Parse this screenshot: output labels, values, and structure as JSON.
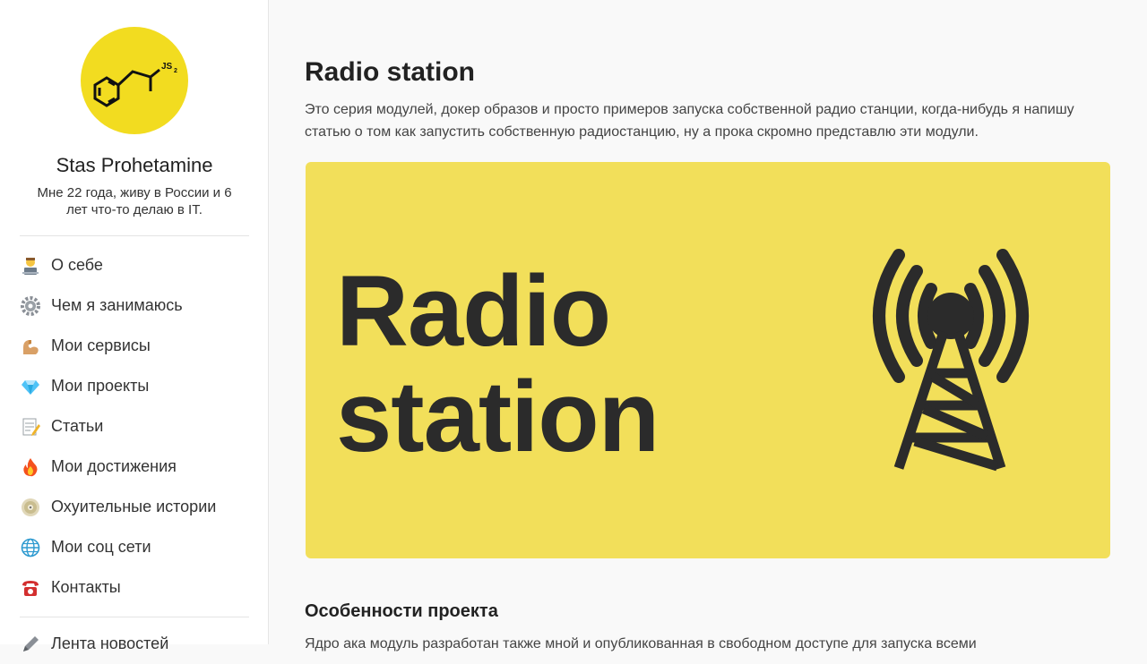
{
  "author": {
    "name": "Stas Prohetamine",
    "bio": "Мне 22 года, живу в России и 6 лет что-то делаю в IT.",
    "avatar_label": "JS",
    "avatar_subscript": "2"
  },
  "nav": {
    "items": [
      {
        "label": "О себе",
        "icon": "technologist-icon"
      },
      {
        "label": "Чем я занимаюсь",
        "icon": "gear-icon"
      },
      {
        "label": "Мои сервисы",
        "icon": "flexed-biceps-icon"
      },
      {
        "label": "Мои проекты",
        "icon": "gem-icon"
      },
      {
        "label": "Статьи",
        "icon": "memo-icon"
      },
      {
        "label": "Мои достижения",
        "icon": "fire-icon"
      },
      {
        "label": "Охуительные истории",
        "icon": "dvd-icon"
      },
      {
        "label": "Мои соц сети",
        "icon": "globe-icon"
      },
      {
        "label": "Контакты",
        "icon": "telephone-icon"
      },
      {
        "label": "Лента новостей",
        "icon": "pencil-icon"
      }
    ]
  },
  "article": {
    "title": "Radio station",
    "intro": "Это серия модулей, докер образов и просто примеров запуска собственной радио станции, когда-нибудь я напишу статью о том как запустить собственную радиостанцию, ну а прока скромно представлю эти модули.",
    "banner_line1": "Radio",
    "banner_line2": "station",
    "section_title": "Особенности проекта",
    "section_text": "Ядро ака модуль разработан также мной и опубликованная в свободном доступе для запуска всеми"
  },
  "colors": {
    "avatar_bg": "#f2dc20",
    "banner_bg": "#f2df5a",
    "banner_ink": "#2b2b2b"
  }
}
